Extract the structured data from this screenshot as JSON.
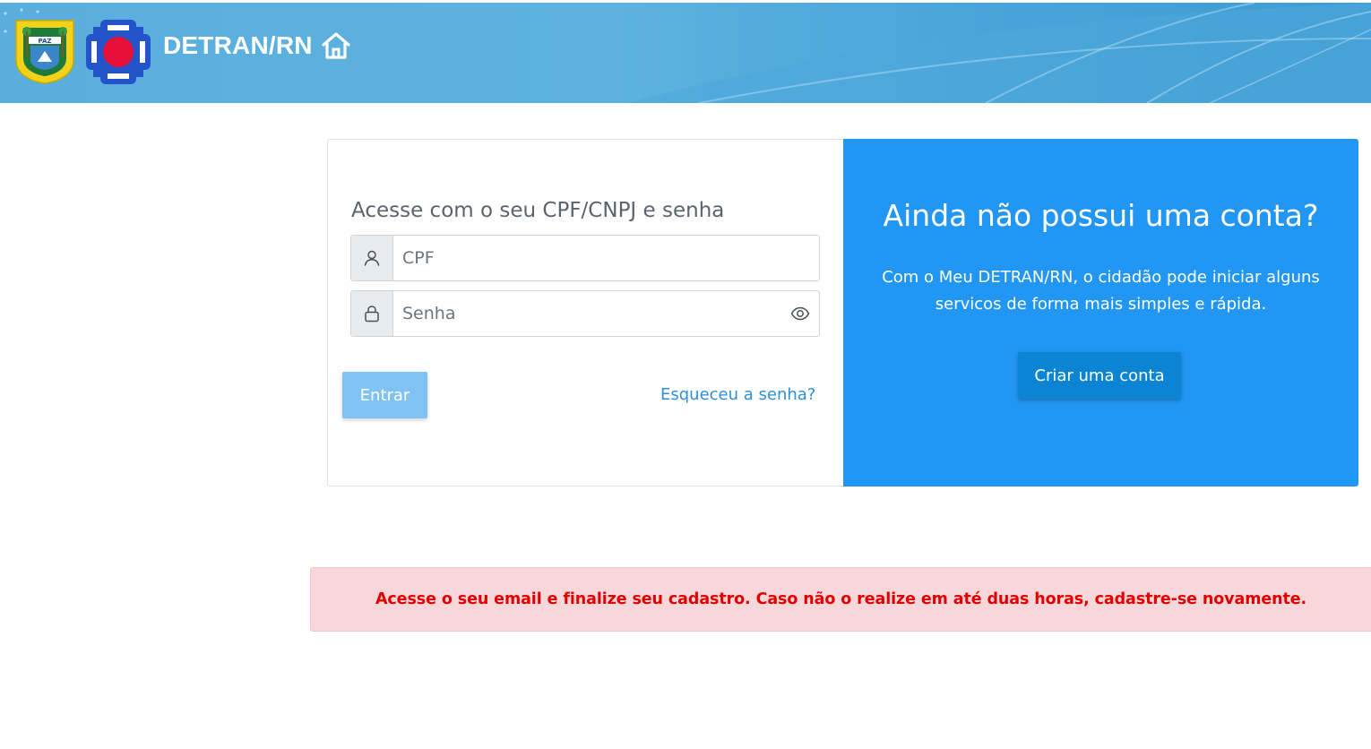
{
  "header": {
    "title": "DETRAN/RN",
    "background_color": "#5db2df",
    "rn_logo_icon": "rn-coat-of-arms-icon",
    "detran_logo_icon": "detran-logo-icon",
    "home_icon": "home-icon"
  },
  "login": {
    "heading": "Acesse com o seu CPF/CNPJ e senha",
    "cpf_placeholder": "CPF",
    "cpf_value": "",
    "senha_placeholder": "Senha",
    "senha_value": "",
    "submit_label": "Entrar",
    "forgot_label": "Esqueceu a senha?",
    "submit_color": "#80c2f3",
    "link_color": "#2d8fd8"
  },
  "signup": {
    "heading": "Ainda não possui uma conta?",
    "text": "Com o Meu DETRAN/RN, o cidadão pode iniciar alguns servicos de forma mais simples e rápida.",
    "button_label": "Criar uma conta",
    "panel_color": "#2196f3",
    "button_color": "#0b84d4"
  },
  "alert": {
    "message": "Acesse o seu email e finalize seu cadastro. Caso não o realize em até duas horas, cadastre-se novamente.",
    "background_color": "#f8d7da",
    "text_color": "#e00000"
  }
}
